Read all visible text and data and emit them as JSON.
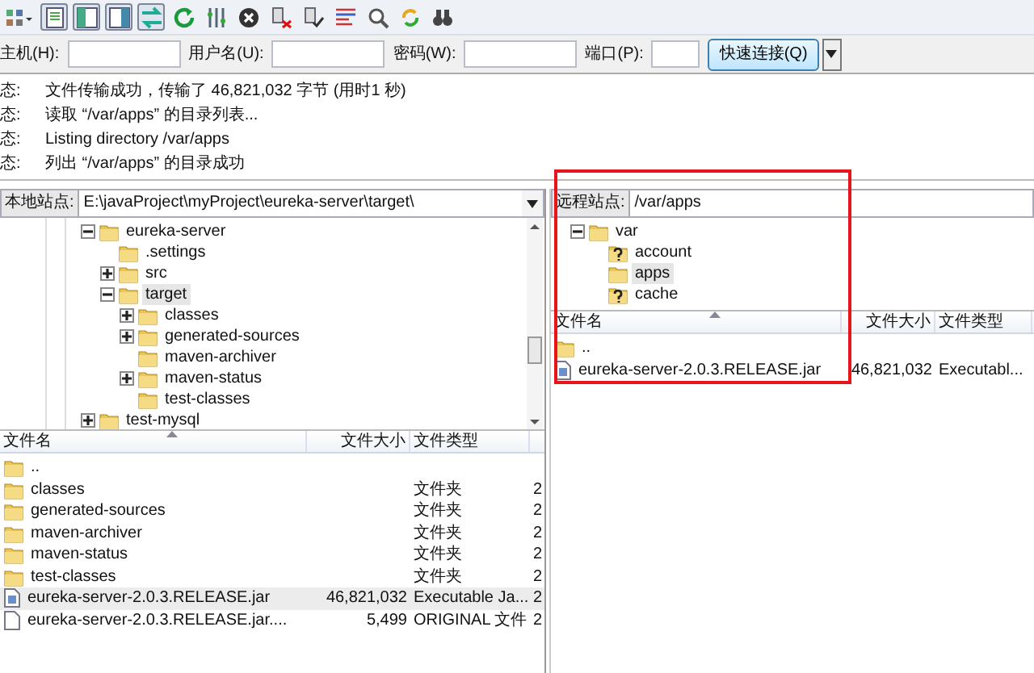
{
  "toolbar": {
    "toggles": [
      {
        "pressed": true
      },
      {
        "pressed": true
      },
      {
        "pressed": true
      },
      {
        "pressed": true
      }
    ]
  },
  "quickconnect": {
    "fields": [
      {
        "label": "主机(H):"
      },
      {
        "label": "用户名(U):"
      },
      {
        "label": "密码(W):"
      },
      {
        "label": "端口(P):"
      }
    ],
    "button": "快速连接(Q)"
  },
  "log": [
    {
      "label": "态:",
      "message": "文件传输成功，传输了 46,821,032 字节 (用时1 秒)"
    },
    {
      "label": "态:",
      "message": "读取 “/var/apps” 的目录列表..."
    },
    {
      "label": "态:",
      "message": "Listing directory /var/apps"
    },
    {
      "label": "态:",
      "message": "列出 “/var/apps” 的目录成功"
    }
  ],
  "local": {
    "site_label": "本地站点:",
    "path": "E:\\javaProject\\myProject\\eureka-server\\target\\",
    "tree": [
      {
        "label": "eureka-server",
        "kind": "folder",
        "expanded": true,
        "selected": false,
        "children": [
          {
            "label": ".settings",
            "kind": "folder",
            "selected": false
          },
          {
            "label": "src",
            "kind": "folder",
            "expanded": false,
            "selected": false
          },
          {
            "label": "target",
            "kind": "folder",
            "expanded": true,
            "selected": true,
            "children": [
              {
                "label": "classes",
                "kind": "folder",
                "expanded": false,
                "selected": false
              },
              {
                "label": "generated-sources",
                "kind": "folder",
                "expanded": false,
                "selected": false
              },
              {
                "label": "maven-archiver",
                "kind": "folder",
                "selected": false
              },
              {
                "label": "maven-status",
                "kind": "folder",
                "expanded": false,
                "selected": false
              },
              {
                "label": "test-classes",
                "kind": "folder",
                "selected": false
              }
            ]
          }
        ]
      },
      {
        "label": "test-mysql",
        "kind": "folder",
        "expanded": false,
        "selected": false
      }
    ],
    "columns": [
      "文件名",
      "文件大小",
      "文件类型"
    ],
    "rows": [
      {
        "name": "..",
        "kind": "folder",
        "selected": false
      },
      {
        "name": "classes",
        "kind": "folder",
        "type": "文件夹",
        "column_4": "2",
        "selected": false
      },
      {
        "name": "generated-sources",
        "kind": "folder",
        "type": "文件夹",
        "column_4": "2",
        "selected": false
      },
      {
        "name": "maven-archiver",
        "kind": "folder",
        "type": "文件夹",
        "column_4": "2",
        "selected": false
      },
      {
        "name": "maven-status",
        "kind": "folder",
        "type": "文件夹",
        "column_4": "2",
        "selected": false
      },
      {
        "name": "test-classes",
        "kind": "folder",
        "type": "文件夹",
        "column_4": "2",
        "selected": false
      },
      {
        "name": "eureka-server-2.0.3.RELEASE.jar",
        "kind": "jar",
        "size": "46,821,032",
        "type": "Executable Ja...",
        "column_4": "2",
        "selected": true
      },
      {
        "name": "eureka-server-2.0.3.RELEASE.jar....",
        "kind": "file",
        "size": "5,499",
        "type": "ORIGINAL 文件",
        "column_4": "2",
        "selected": false
      }
    ]
  },
  "remote": {
    "site_label": "远程站点:",
    "path": "/var/apps",
    "tree": [
      {
        "label": "var",
        "kind": "folder",
        "expanded": true,
        "selected": false,
        "children": [
          {
            "label": "account",
            "kind": "unknown",
            "selected": false
          },
          {
            "label": "apps",
            "kind": "folder",
            "selected": true
          },
          {
            "label": "cache",
            "kind": "unknown",
            "selected": false
          }
        ]
      }
    ],
    "columns": [
      "文件名",
      "文件大小",
      "文件类型"
    ],
    "rows": [
      {
        "name": "..",
        "kind": "folder",
        "selected": false
      },
      {
        "name": "eureka-server-2.0.3.RELEASE.jar",
        "kind": "jar",
        "size": "46,821,032",
        "type": "Executabl...",
        "selected": false
      }
    ]
  },
  "highlight_frame": {
    "shown": true
  }
}
